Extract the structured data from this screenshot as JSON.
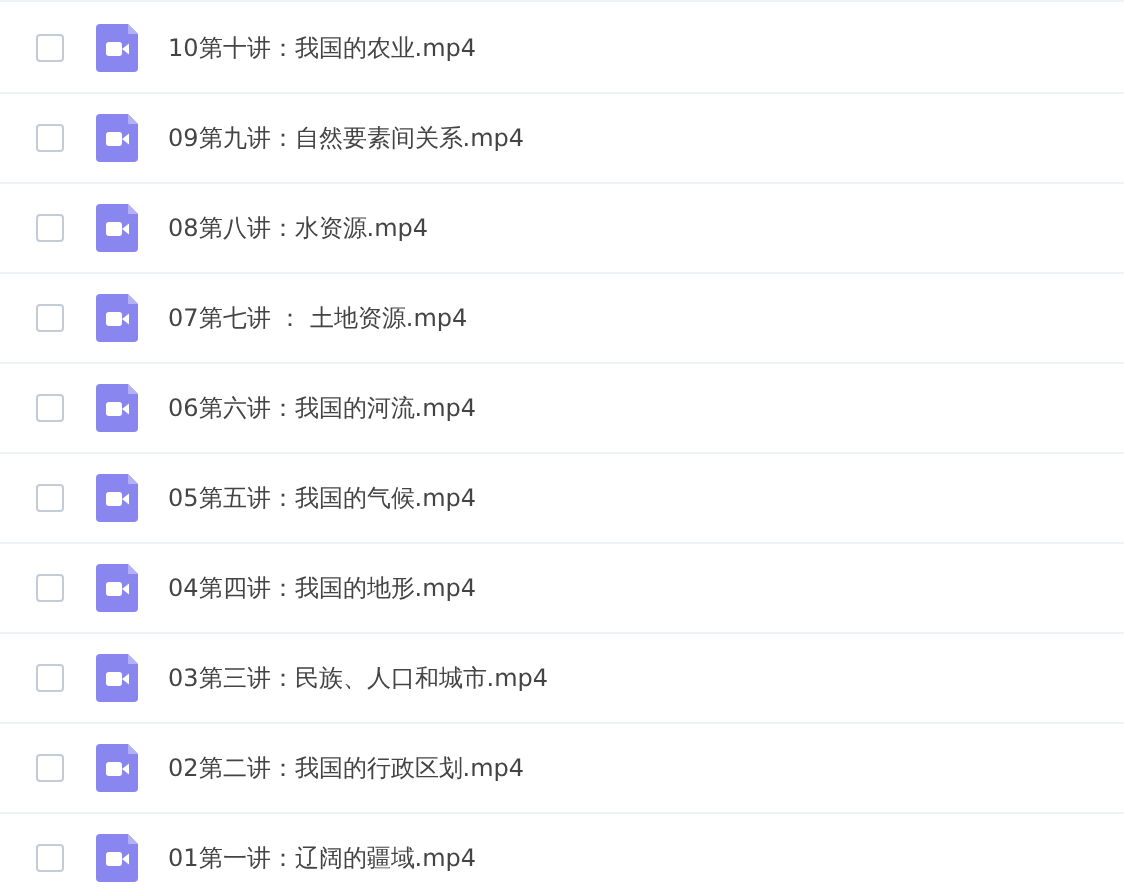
{
  "files": [
    {
      "name": "10第十讲：我国的农业.mp4",
      "checked": false
    },
    {
      "name": "09第九讲：自然要素间关系.mp4",
      "checked": false
    },
    {
      "name": "08第八讲：水资源.mp4",
      "checked": false
    },
    {
      "name": "07第七讲 ： 土地资源.mp4",
      "checked": false
    },
    {
      "name": "06第六讲：我国的河流.mp4",
      "checked": false
    },
    {
      "name": "05第五讲：我国的气候.mp4",
      "checked": false
    },
    {
      "name": "04第四讲：我国的地形.mp4",
      "checked": false
    },
    {
      "name": "03第三讲：民族、人口和城市.mp4",
      "checked": false
    },
    {
      "name": "02第二讲：我国的行政区划.mp4",
      "checked": false
    },
    {
      "name": "01第一讲：辽阔的疆域.mp4",
      "checked": false
    }
  ]
}
